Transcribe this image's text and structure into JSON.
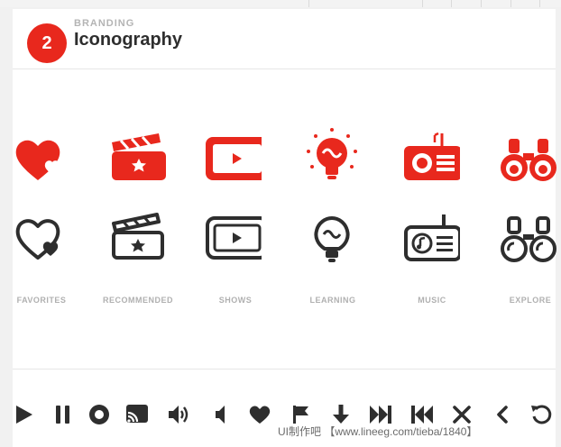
{
  "section": {
    "number": "2",
    "eyebrow": "BRANDING",
    "title": "Iconography"
  },
  "icons": [
    {
      "label": "FAVORITES",
      "icon": "heart-icon"
    },
    {
      "label": "RECOMMENDED",
      "icon": "clapperboard-icon"
    },
    {
      "label": "SHOWS",
      "icon": "tv-play-icon"
    },
    {
      "label": "LEARNING",
      "icon": "lightbulb-icon"
    },
    {
      "label": "MUSIC",
      "icon": "radio-icon"
    },
    {
      "label": "EXPLORE",
      "icon": "binoculars-icon"
    }
  ],
  "colors": {
    "accent": "#e8281d",
    "dark": "#2e2e2e",
    "label": "#b0b0b0"
  },
  "controls": [
    "play-icon",
    "pause-icon",
    "stop-icon",
    "cast-icon",
    "volume-up-icon",
    "volume-low-icon",
    "heart-icon",
    "flag-icon",
    "download-arrow-icon",
    "skip-forward-icon",
    "skip-back-icon",
    "close-icon",
    "chevron-left-icon",
    "replay-icon"
  ],
  "watermark": "UI制作吧 【www.lineeg.com/tieba/1840】"
}
